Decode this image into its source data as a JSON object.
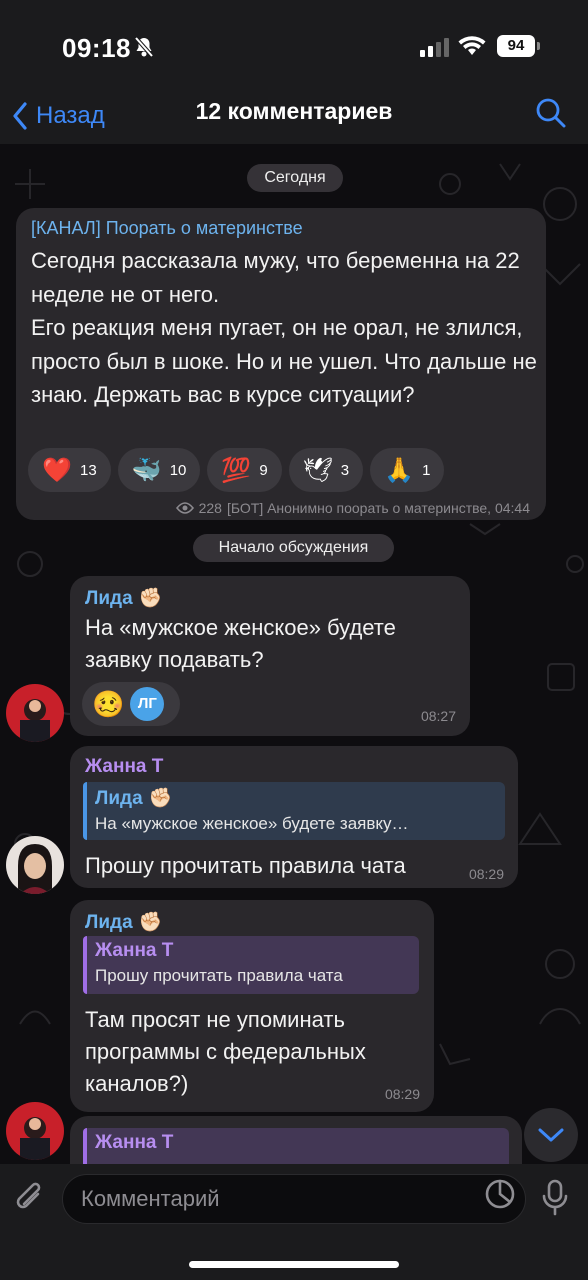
{
  "status": {
    "time": "09:18",
    "battery": "94",
    "icons": [
      "bell-slash-icon",
      "cellular-signal-icon",
      "wifi-icon",
      "battery-icon"
    ]
  },
  "nav": {
    "back_label": "Назад",
    "title": "12 комментариев",
    "accent": "#3e88f7"
  },
  "chat": {
    "date_label": "Сегодня",
    "post": {
      "channel": "[КАНАЛ] Поорать о материнстве",
      "text": "Сегодня рассказала мужу, что беременна на 22 неделе не от него.\nЕго реакция меня пугает, он не орал, не злился, просто был в шоке. Но и не ушел. Что дальше не знаю. Держать вас в курсе ситуации?",
      "reactions": [
        {
          "emoji": "❤️",
          "count": "13"
        },
        {
          "emoji": "🐳",
          "count": "10"
        },
        {
          "emoji": "💯",
          "count": "9"
        },
        {
          "emoji": "🕊",
          "count": "3"
        },
        {
          "emoji": "🙏",
          "count": "1"
        }
      ],
      "views": "228",
      "author_time": "[БОТ] Анонимно поорать о материнстве, 04:44"
    },
    "discussion_label": "Начало обсуждения",
    "messages": [
      {
        "sender": "Лида",
        "sender_emoji": "✊🏻",
        "text": "На «мужское женское» будете заявку подавать?",
        "reaction_emoji": "🥴",
        "reaction_badge": "ЛГ",
        "time": "08:27"
      },
      {
        "sender": "Жанна Т",
        "quote_name": "Лида",
        "quote_emoji": "✊🏻",
        "quote_text": "На «мужское женское» будете заявку…",
        "text": "Прошу прочитать правила чата",
        "time": "08:29"
      },
      {
        "sender": "Лида",
        "sender_emoji": "✊🏻",
        "quote_name": "Жанна Т",
        "quote_text": "Прошу прочитать правила чата",
        "text": "Там просят не упоминать программы с федеральных каналов?)",
        "time": "08:29"
      },
      {
        "quote_name": "Жанна Т"
      }
    ]
  },
  "input": {
    "placeholder": "Комментарий"
  },
  "colors": {
    "lida_name": "#6db3ee",
    "zhanna_name": "#b78ef0",
    "bubble": "#2a282c"
  }
}
